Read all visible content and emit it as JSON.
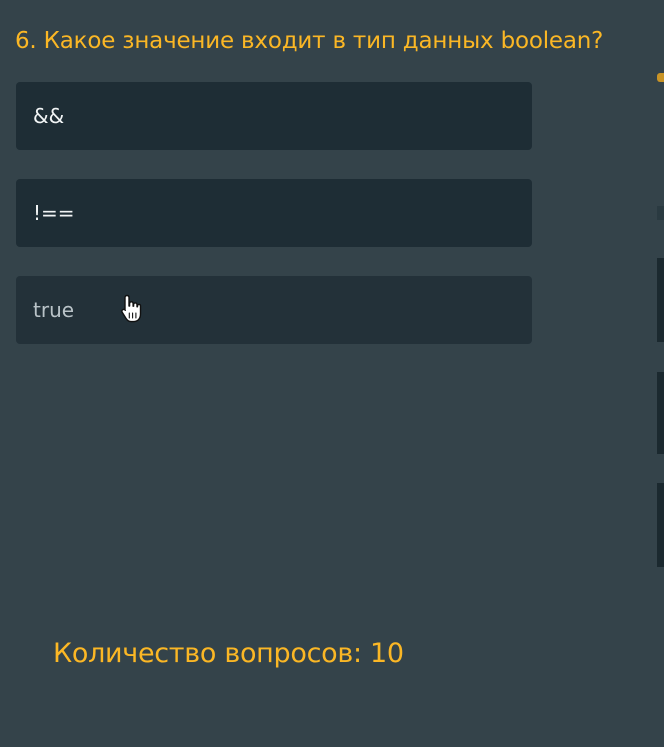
{
  "quiz": {
    "question": "6. Какое значение входит в тип данных boolean?",
    "answers": [
      {
        "label": "&&"
      },
      {
        "label": "!=="
      },
      {
        "label": "true"
      }
    ],
    "counter_text": "Количество вопросов: 10"
  },
  "colors": {
    "background": "#34434a",
    "accent": "#fbb725",
    "answer_background": "#1e2d35",
    "answer_text": "#f1f4f5"
  },
  "icons": {
    "cursor": "hand-pointer-icon"
  }
}
